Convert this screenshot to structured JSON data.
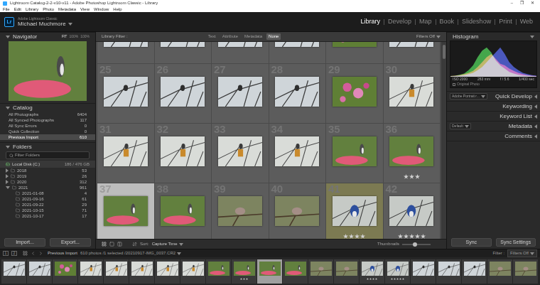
{
  "window": {
    "title": "Lightroom Catalog-2-2-v10-v11 - Adobe Photoshop Lightroom Classic - Library",
    "controls": [
      "–",
      "❐",
      "✕"
    ]
  },
  "menu": [
    "File",
    "Edit",
    "Library",
    "Photo",
    "Metadata",
    "View",
    "Window",
    "Help"
  ],
  "identity": {
    "logo": "Lr",
    "product": "Adobe Lightroom Classic",
    "user": "Michael Muchmore"
  },
  "modules": [
    {
      "label": "Library",
      "selected": true
    },
    {
      "label": "Develop",
      "selected": false
    },
    {
      "label": "Map",
      "selected": false
    },
    {
      "label": "Book",
      "selected": false
    },
    {
      "label": "Slideshow",
      "selected": false
    },
    {
      "label": "Print",
      "selected": false
    },
    {
      "label": "Web",
      "selected": false
    }
  ],
  "navigator": {
    "title": "Navigator",
    "expanded": true,
    "zooms": [
      {
        "label": "FIT",
        "selected": true
      },
      {
        "label": "100%",
        "selected": false
      },
      {
        "label": "100%",
        "selected": false
      }
    ]
  },
  "catalog": {
    "title": "Catalog",
    "expanded": true,
    "items": [
      {
        "label": "All Photographs",
        "count": "6404",
        "selected": false
      },
      {
        "label": "All Synced Photographs",
        "count": "117",
        "selected": false
      },
      {
        "label": "All Sync Errors",
        "count": "0",
        "selected": false
      },
      {
        "label": "Quick Collection",
        "count": "0",
        "selected": false
      },
      {
        "label": "Previous Import",
        "count": "610",
        "selected": true
      }
    ]
  },
  "folders": {
    "title": "Folders",
    "expanded": true,
    "filter": "Filter Folders",
    "volume": {
      "label": "Local Disk (C:)",
      "usage": "186 / 476 GB"
    },
    "items": [
      {
        "label": "2018",
        "count": "53",
        "kind": "folder",
        "expanded": false
      },
      {
        "label": "2019",
        "count": "26",
        "kind": "folder",
        "expanded": false
      },
      {
        "label": "2020",
        "count": "312",
        "kind": "folder",
        "expanded": false
      },
      {
        "label": "2021",
        "count": "961",
        "kind": "folder",
        "expanded": true
      },
      {
        "label": "2021-01-08",
        "count": "4",
        "kind": "subfolder"
      },
      {
        "label": "2021-09-16",
        "count": "61",
        "kind": "subfolder"
      },
      {
        "label": "2021-09-22",
        "count": "29",
        "kind": "subfolder"
      },
      {
        "label": "2021-10-15",
        "count": "71",
        "kind": "subfolder"
      },
      {
        "label": "2021-10-17",
        "count": "17",
        "kind": "subfolder"
      }
    ]
  },
  "left_buttons": [
    "Import...",
    "Export..."
  ],
  "library_filter": {
    "label": "Library Filter :",
    "options": [
      {
        "label": "Text",
        "selected": false
      },
      {
        "label": "Attribute",
        "selected": false
      },
      {
        "label": "Metadata",
        "selected": false
      },
      {
        "label": "None",
        "selected": true
      }
    ],
    "preset": "Filters Off"
  },
  "grid": {
    "partial_row": [
      {
        "kind": "branches"
      },
      {
        "kind": "branches"
      },
      {
        "kind": "branches"
      },
      {
        "kind": "branches"
      },
      {
        "kind": "flowers"
      },
      {
        "kind": "branches"
      }
    ],
    "cells": [
      {
        "number": "25",
        "kind": "branches",
        "selected": false,
        "stars": 0
      },
      {
        "number": "26",
        "kind": "branches",
        "selected": false,
        "stars": 0
      },
      {
        "number": "27",
        "kind": "branches",
        "selected": false,
        "stars": 0
      },
      {
        "number": "28",
        "kind": "branches",
        "selected": false,
        "stars": 0
      },
      {
        "number": "29",
        "kind": "flowers",
        "selected": false,
        "stars": 0
      },
      {
        "number": "30",
        "kind": "oriole",
        "selected": false,
        "stars": 0
      },
      {
        "number": "31",
        "kind": "oriole",
        "selected": false,
        "stars": 0
      },
      {
        "number": "32",
        "kind": "oriole",
        "selected": false,
        "stars": 0
      },
      {
        "number": "33",
        "kind": "oriole",
        "selected": false,
        "stars": 0
      },
      {
        "number": "34",
        "kind": "oriole",
        "selected": false,
        "stars": 0
      },
      {
        "number": "35",
        "kind": "feeder",
        "selected": false,
        "stars": 0
      },
      {
        "number": "36",
        "kind": "feeder",
        "selected": false,
        "stars": 3
      },
      {
        "number": "37",
        "kind": "feeder",
        "selected": true,
        "stars": 0
      },
      {
        "number": "38",
        "kind": "feeder",
        "selected": false,
        "stars": 0
      },
      {
        "number": "39",
        "kind": "ground",
        "selected": false,
        "stars": 0
      },
      {
        "number": "40",
        "kind": "ground",
        "selected": false,
        "stars": 0
      },
      {
        "number": "41",
        "kind": "jay",
        "selected": false,
        "stars": 4,
        "color": "#7c7a52"
      },
      {
        "number": "42",
        "kind": "jay",
        "selected": false,
        "stars": 5
      }
    ]
  },
  "toolbar": {
    "sort_label": "Sort:",
    "sort": "Capture Time",
    "thumbnails_label": "Thumbnails",
    "level": 0.45
  },
  "histogram": {
    "title": "Histogram",
    "expanded": true,
    "series": [
      {
        "name": "red",
        "color": "#e0403a",
        "values": [
          2,
          3,
          5,
          8,
          12,
          18,
          30,
          45,
          60,
          70,
          55,
          40,
          35,
          25,
          18,
          12,
          8,
          5,
          3,
          2
        ]
      },
      {
        "name": "green",
        "color": "#3fd04a",
        "values": [
          2,
          3,
          6,
          10,
          20,
          35,
          60,
          80,
          90,
          75,
          50,
          35,
          25,
          15,
          10,
          6,
          4,
          3,
          2,
          1
        ]
      },
      {
        "name": "blue",
        "color": "#4a5cf0",
        "values": [
          1,
          2,
          3,
          5,
          8,
          12,
          20,
          30,
          45,
          60,
          75,
          90,
          70,
          45,
          30,
          20,
          12,
          8,
          5,
          3
        ]
      }
    ],
    "info": [
      "ISO 2000",
      "263 mm",
      "f / 5.6",
      "1/400 sec"
    ],
    "original_photo": {
      "label": "Original Photo",
      "checked": false
    }
  },
  "right_panels": [
    {
      "title": "Quick Develop",
      "kind": "preset",
      "value": "Adobe Portrait r...",
      "expanded": false
    },
    {
      "title": "Keywording",
      "kind": "plain",
      "expanded": false
    },
    {
      "title": "Keyword List",
      "kind": "plain",
      "expanded": false
    },
    {
      "title": "Metadata",
      "kind": "preset",
      "value": "Default",
      "expanded": false
    },
    {
      "title": "Comments",
      "kind": "plain",
      "expanded": false
    }
  ],
  "right_buttons": [
    "Sync",
    "Sync Settings"
  ],
  "status": {
    "pages": [
      "1",
      "2"
    ],
    "source": "Previous Import",
    "info": "610 photos /1 selected /20210917-IMG_0037.CR2",
    "filter_label": "Filter :",
    "filter": "Filters Off"
  },
  "filmstrip": [
    {
      "kind": "branches",
      "selected": false,
      "stars": 0
    },
    {
      "kind": "branches",
      "selected": false,
      "stars": 0
    },
    {
      "kind": "flowers",
      "selected": false,
      "stars": 0
    },
    {
      "kind": "oriole",
      "selected": false,
      "stars": 0
    },
    {
      "kind": "oriole",
      "selected": false,
      "stars": 0
    },
    {
      "kind": "oriole",
      "selected": false,
      "stars": 0
    },
    {
      "kind": "oriole",
      "selected": false,
      "stars": 0
    },
    {
      "kind": "oriole",
      "selected": false,
      "stars": 0
    },
    {
      "kind": "feeder",
      "selected": false,
      "stars": 0
    },
    {
      "kind": "feeder",
      "selected": false,
      "stars": 3
    },
    {
      "kind": "feeder",
      "selected": true,
      "stars": 0
    },
    {
      "kind": "feeder",
      "selected": false,
      "stars": 0
    },
    {
      "kind": "ground",
      "selected": false,
      "stars": 0
    },
    {
      "kind": "ground",
      "selected": false,
      "stars": 0
    },
    {
      "kind": "jay",
      "selected": false,
      "stars": 4
    },
    {
      "kind": "jay",
      "selected": false,
      "stars": 5
    },
    {
      "kind": "branches",
      "selected": false,
      "stars": 0
    },
    {
      "kind": "branches",
      "selected": false,
      "stars": 0
    },
    {
      "kind": "branches",
      "selected": false,
      "stars": 0
    },
    {
      "kind": "ground",
      "selected": false,
      "stars": 0
    },
    {
      "kind": "ground",
      "selected": false,
      "stars": 0
    }
  ]
}
